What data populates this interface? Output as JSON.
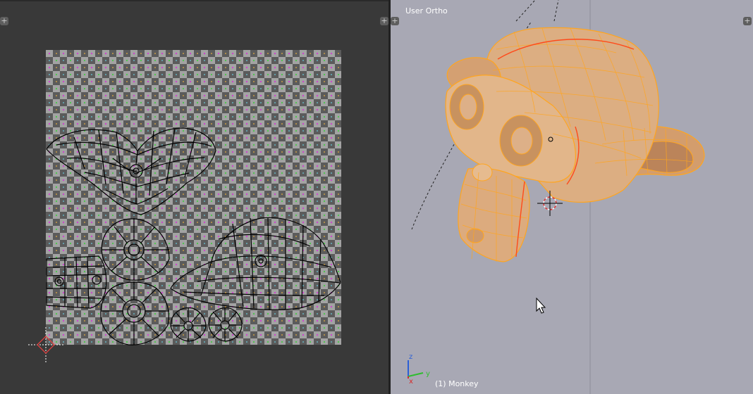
{
  "uv_editor": {
    "panel_name": "uv-image-editor",
    "header_toggle_icon": "plus-icon"
  },
  "viewport_3d": {
    "view_label": "User Ortho",
    "object_label": "(1) Monkey",
    "header_toggle_icon": "plus-icon",
    "axis_labels": {
      "x": "x",
      "y": "y",
      "z": "z"
    },
    "colors": {
      "background": "#a8a8b4",
      "mesh_fill": "#d9a878",
      "wire_selected": "#ffa51f",
      "seam": "#ff4a1a",
      "axis_x": "#d62b2b",
      "axis_y": "#2fbd2f",
      "axis_z": "#2b5fd6"
    }
  },
  "cursor": {
    "icon": "mouse-pointer-icon"
  }
}
